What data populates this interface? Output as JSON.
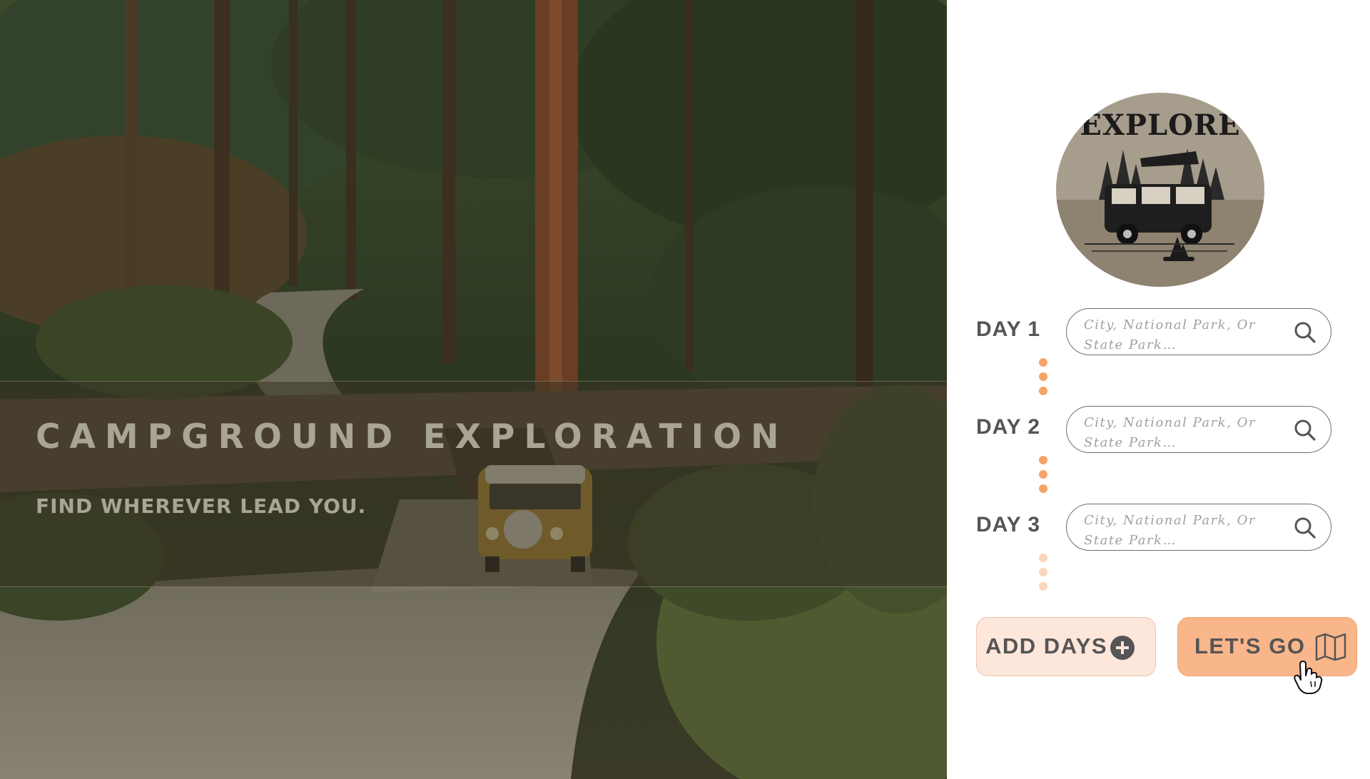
{
  "hero": {
    "title": "CAMPGROUND EXPLORATION",
    "subtitle": "FIND WHEREVER LEAD YOU."
  },
  "logo": {
    "text": "EXPLORE"
  },
  "trip": {
    "days": [
      {
        "label": "DAY 1",
        "placeholder": "City, National Park, Or State Park…"
      },
      {
        "label": "DAY 2",
        "placeholder": "City, National Park, Or State Park…"
      },
      {
        "label": "DAY 3",
        "placeholder": "City, National Park, Or State Park…"
      }
    ]
  },
  "actions": {
    "add_days_label": "ADD DAYS",
    "lets_go_label": "LET'S GO"
  },
  "icons": {
    "search": "search-icon",
    "add": "plus-circle-icon",
    "map": "map-icon",
    "cursor": "hand-pointer-icon"
  },
  "colors": {
    "accent": "#f9b68a",
    "accent_light": "#fde6da",
    "dot_active": "#f5a468",
    "dot_faded": "#f9d6bd",
    "label_gray": "#555555"
  }
}
